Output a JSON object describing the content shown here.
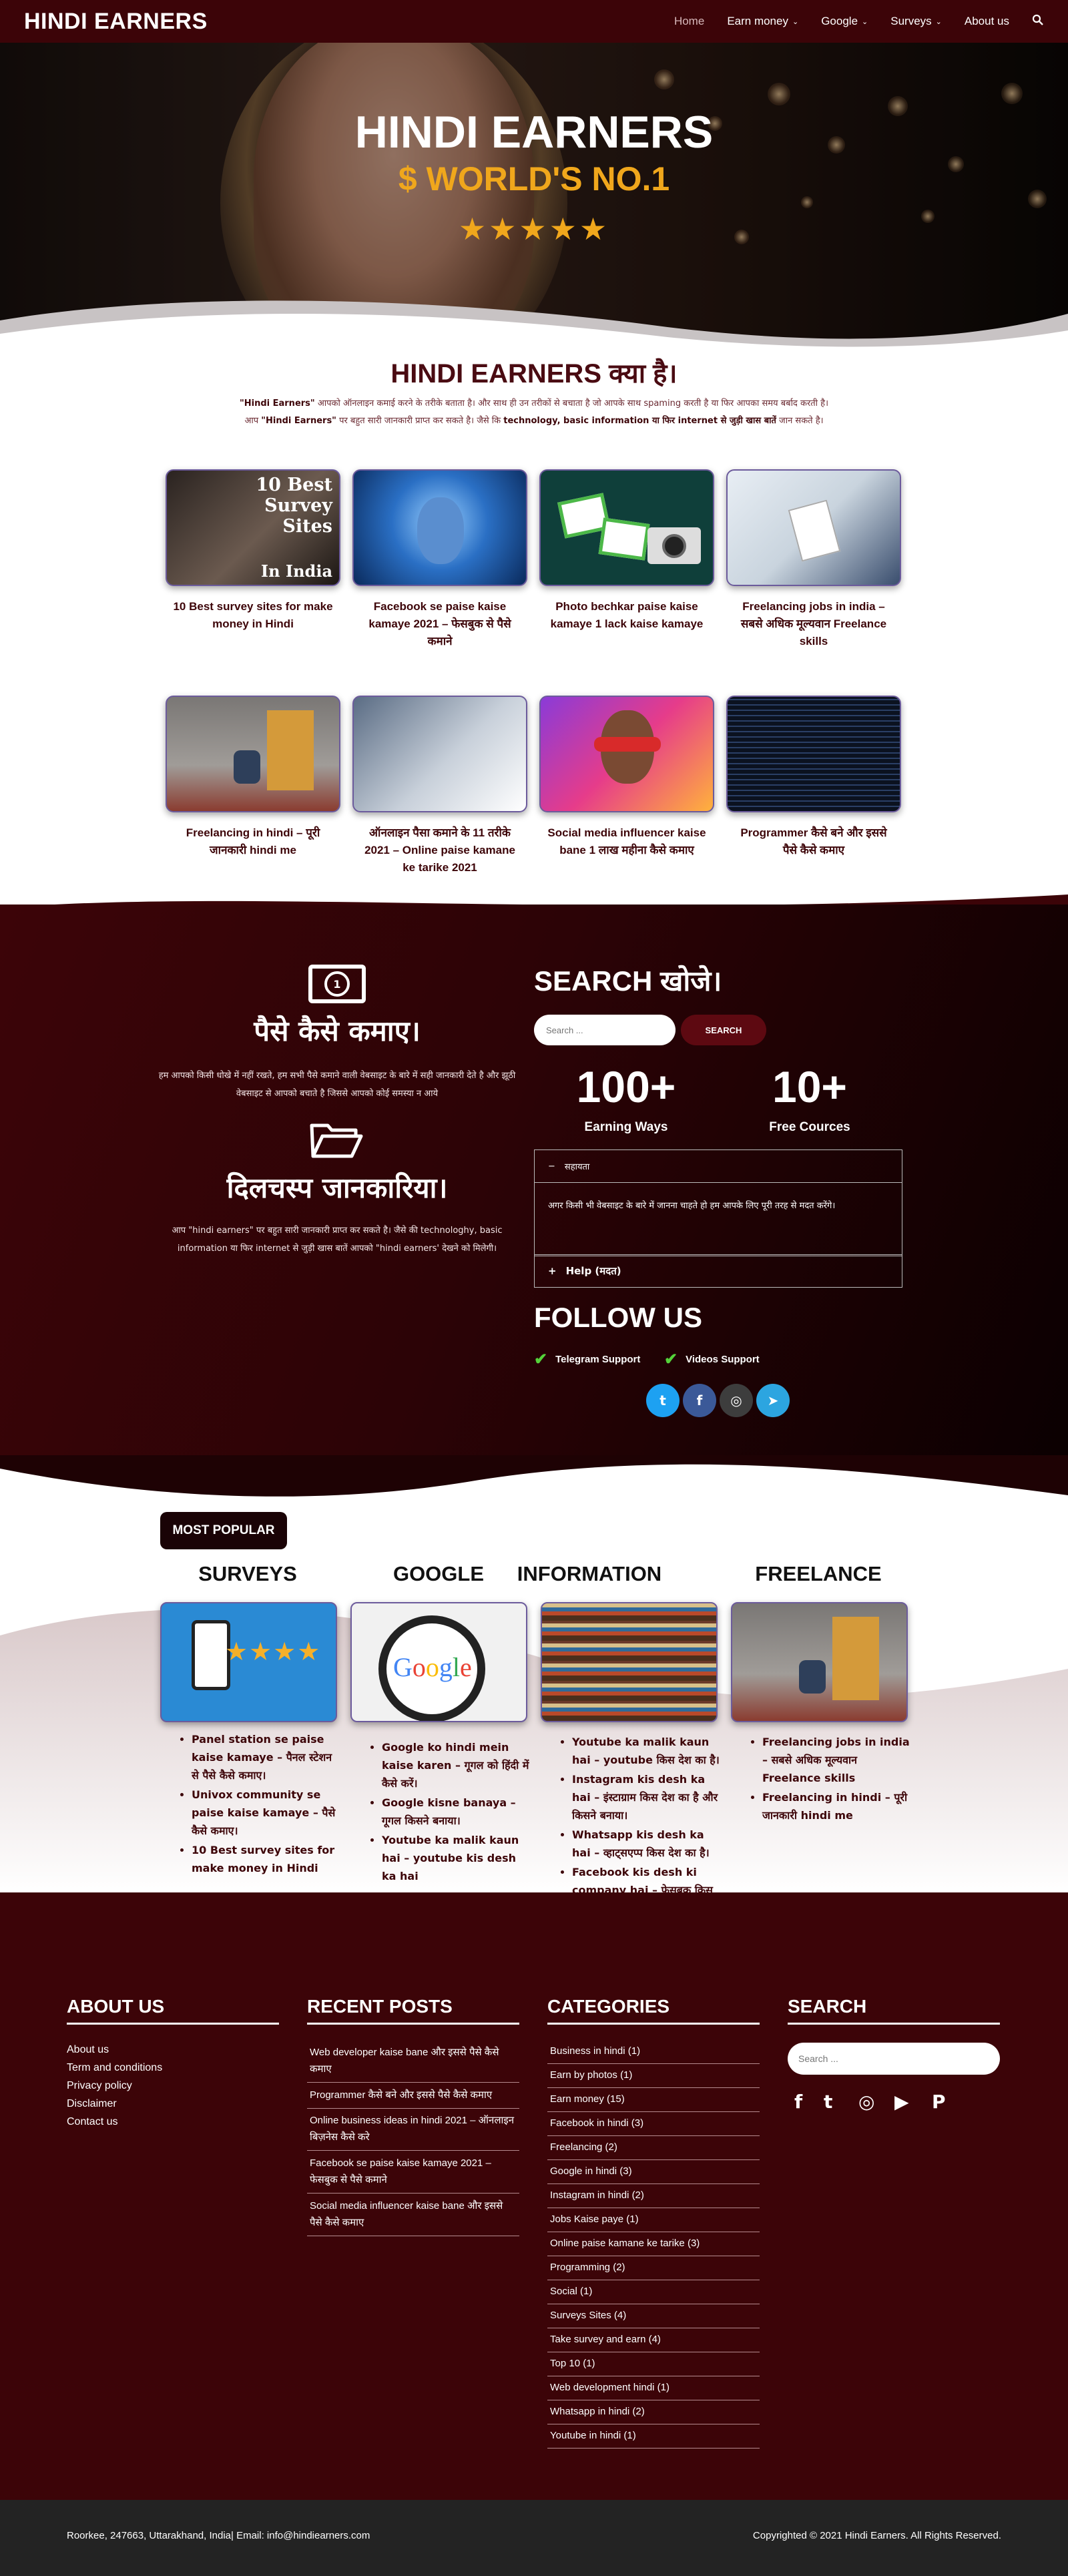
{
  "nav": {
    "logo": "HINDI EARNERS",
    "items": [
      {
        "label": "Home",
        "dropdown": false
      },
      {
        "label": "Earn money",
        "dropdown": true
      },
      {
        "label": "Google",
        "dropdown": true
      },
      {
        "label": "Surveys",
        "dropdown": true
      },
      {
        "label": "About us",
        "dropdown": false
      }
    ],
    "search_icon": "search-icon"
  },
  "hero": {
    "title": "HINDI EARNERS",
    "subtitle": "$ WORLD'S NO.1",
    "stars": "★★★★★"
  },
  "intro": {
    "title": "HINDI EARNERS क्या है।",
    "line1_brand": "\"Hindi Earners\"",
    "line1_rest": " आपको ऑनलाइन कमाई करने के तरीके बताता है। और साथ ही उन तरीकों से बचाता है जो आपके साथ spaming करती है या फिर आपका समय बर्बाद करती है।",
    "line2_pre": "आप ",
    "line2_brand": "\"Hindi Earners\"",
    "line2_mid": " पर बहुत सारी जानकारी प्राप्त कर सकते है। जैसे कि ",
    "line2_bold": "technology, basic information या फिर internet से जुड़ी खास बातें",
    "line2_end": " जान सकते है।"
  },
  "cards": [
    {
      "title": "10 Best survey sites for make money in Hindi",
      "image": "survey-sites-image"
    },
    {
      "title": "Facebook se paise kaise kamaye 2021 – फेसबुक से पैसे कमाने",
      "image": "facebook-image"
    },
    {
      "title": "Photo bechkar paise kaise kamaye 1 lack kaise kamaye",
      "image": "photo-camera-image"
    },
    {
      "title": "Freelancing jobs in india – सबसे अधिक मूल्यवान Freelance skills",
      "image": "freelance-jobs-image"
    },
    {
      "title": "Freelancing in hindi – पूरी जानकारी hindi me",
      "image": "freelancing-image"
    },
    {
      "title": "ऑनलाइन पैसा कमाने के 11 तरीके 2021 – Online paise kamane ke tarike 2021",
      "image": "handshake-image"
    },
    {
      "title": "Social media influencer kaise bane 1 लाख महीना कैसे कमाए",
      "image": "influencer-image"
    },
    {
      "title": "Programmer कैसे बने और इससे पैसे कैसे कमाए",
      "image": "code-image"
    }
  ],
  "survey_card_overlay": {
    "line1": "10 Best",
    "line2": "Survey",
    "line3": "Sites",
    "line4": "In India"
  },
  "dark": {
    "money_heading": "पैसे कैसे कमाए।",
    "money_text": "हम आपको किसी धोखे में नहीं रखते, हम सभी पैसे कमाने वाली वेबसाइट के बारे में सही जानकारी देते है और झूठी वेबसाइट से आपको बचाते है जिससे आपको कोई समस्या न आये",
    "info_heading": "दिलचस्प जानकारिया।",
    "info_text": "आप \"hindi earners\" पर बहुत सारी जानकारी प्राप्त कर सकते है। जैसे की technologhy, basic information या फिर internet से जुड़ी खास बातें आपको \"hindi earners' देखने को मिलेगी।",
    "search_title": "SEARCH खोजे।",
    "search_placeholder": "Search ...",
    "search_button": "SEARCH",
    "stats": [
      {
        "num": "100+",
        "label": "Earning Ways"
      },
      {
        "num": "10+",
        "label": "Free Cources"
      }
    ],
    "accordion": {
      "open_title": "सहायता",
      "open_body": "अगर किसी भी वेबसाइट के बारे में जानना चाहते हो हम आपके लिए पूरी तरह से मदत करेंगे।",
      "closed_title": "Help (मदत)"
    },
    "follow_title": "FOLLOW US",
    "support": [
      "Telegram Support",
      "Videos Support"
    ],
    "social": [
      {
        "icon": "twitter-icon",
        "color": "#1da1f2",
        "glyph": "t"
      },
      {
        "icon": "facebook-icon",
        "color": "#3b5998",
        "glyph": "f"
      },
      {
        "icon": "instagram-icon",
        "color": "#3d3d3d",
        "glyph": "◎"
      },
      {
        "icon": "telegram-icon",
        "color": "#2ca5e0",
        "glyph": "➤"
      }
    ]
  },
  "popular": {
    "badge": "MOST POPULAR",
    "columns": [
      {
        "title": "SURVEYS",
        "items": [
          "Panel station se paise kaise kamaye – पैनल स्टेशन से पैसे कैसे कमाए।",
          "Univox community se paise kaise kamaye – पैसे कैसे कमाए।",
          "10 Best survey sites for make money in Hindi"
        ]
      },
      {
        "title": "GOOGLE",
        "items": [
          "Google ko hindi mein kaise karen – गूगल को हिंदी में कैसे करें।",
          "Google kisne banaya – गूगल किसने बनाया।",
          "Youtube ka malik kaun hai – youtube kis desh ka hai"
        ]
      },
      {
        "title": "INFORMATION",
        "items": [
          "Youtube ka malik kaun hai – youtube किस देश का है।",
          "Instagram kis desh ka hai – इंस्टाग्राम किस देश का है और किसने बनाया।",
          "Whatsapp kis desh ka hai – व्हाट्सएप्प किस देश का है।",
          "Facebook kis desh ki company hai – फेसबुक किस देश की कंपनी है।"
        ]
      },
      {
        "title": "FREELANCE",
        "items": [
          "Freelancing jobs in india – सबसे अधिक मूल्यवान Freelance skills",
          "Freelancing in hindi – पूरी जानकारी hindi me"
        ]
      }
    ]
  },
  "footer": {
    "about_title": "ABOUT US",
    "about_links": [
      "About us",
      "Term and conditions",
      "Privacy policy",
      "Disclaimer",
      "Contact us"
    ],
    "recent_title": "RECENT POSTS",
    "recent_posts": [
      "Web developer kaise bane और इससे पैसे कैसे कमाए",
      "Programmer कैसे बने और इससे पैसे कैसे कमाए",
      "Online business ideas in hindi 2021 – ऑनलाइन बिज़नेस कैसे करे",
      "Facebook se paise kaise kamaye 2021 – फेसबुक से पैसे कमाने",
      "Social media influencer kaise bane और इससे पैसे कैसे कमाए"
    ],
    "categories_title": "CATEGORIES",
    "categories": [
      "Business in hindi (1)",
      "Earn by photos (1)",
      "Earn money (15)",
      "Facebook in hindi (3)",
      "Freelancing (2)",
      "Google in hindi (3)",
      "Instagram in hindi (2)",
      "Jobs Kaise paye (1)",
      "Online paise kamane ke tarike (3)",
      "Programming (2)",
      "Social (1)",
      "Surveys Sites (4)",
      "Take survey and earn (4)",
      "Top 10 (1)",
      "Web development hindi (1)",
      "Whatsapp in hindi (2)",
      "Youtube in hindi (1)"
    ],
    "search_title": "SEARCH",
    "search_placeholder": "Search ...",
    "social": [
      {
        "icon": "facebook-icon",
        "glyph": "f"
      },
      {
        "icon": "twitter-icon",
        "glyph": "t"
      },
      {
        "icon": "instagram-icon",
        "glyph": "◎"
      },
      {
        "icon": "youtube-icon",
        "glyph": "▶"
      },
      {
        "icon": "pinterest-icon",
        "glyph": "P"
      }
    ]
  },
  "bottom": {
    "address": "Roorkee, 247663, Uttarakhand, India| Email: info@hindiearners.com",
    "copyright": "Copyrighted © 2021 Hindi Earners. All Rights Reserved."
  }
}
